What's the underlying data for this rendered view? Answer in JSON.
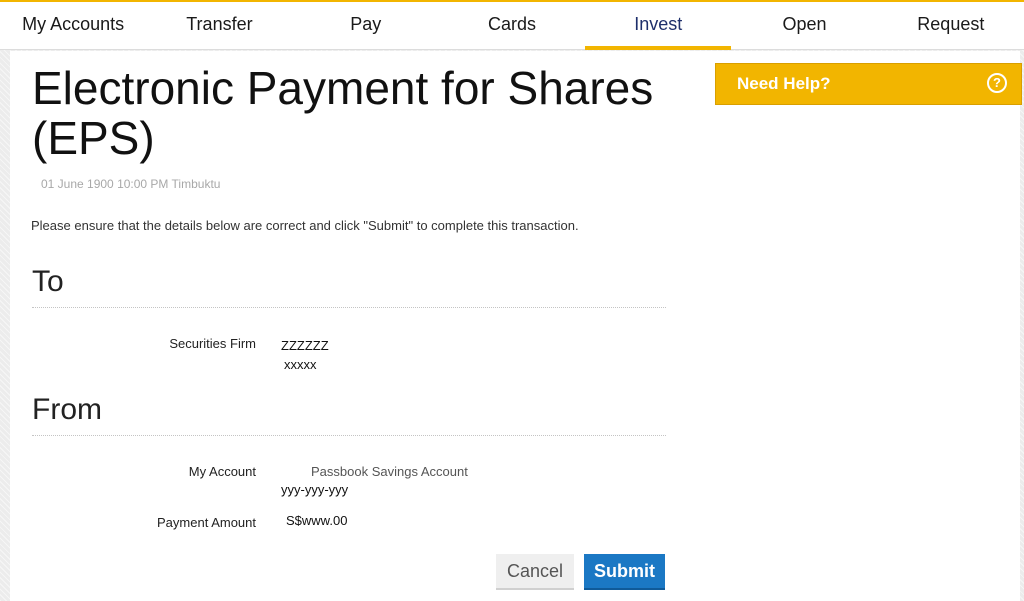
{
  "nav": {
    "items": [
      {
        "label": "My Accounts"
      },
      {
        "label": "Transfer"
      },
      {
        "label": "Pay"
      },
      {
        "label": "Cards"
      },
      {
        "label": "Invest",
        "active": true
      },
      {
        "label": "Open"
      },
      {
        "label": "Request"
      }
    ]
  },
  "page": {
    "title": "Electronic Payment for Shares (EPS)",
    "timestamp": "01 June 1900 10:00 PM Timbuktu",
    "instruction": "Please ensure that the details below are correct and click \"Submit\" to complete this transaction."
  },
  "to_section": {
    "heading": "To",
    "securities_firm_label": "Securities Firm",
    "securities_firm_name": "ZZZZZZ",
    "securities_firm_code": "xxxxx"
  },
  "from_section": {
    "heading": "From",
    "my_account_label": "My Account",
    "account_type": "Passbook Savings Account",
    "account_number": "yyy-yyy-yyy",
    "payment_amount_label": "Payment Amount",
    "payment_amount": "S$www.00"
  },
  "actions": {
    "cancel_label": "Cancel",
    "submit_label": "Submit"
  },
  "help": {
    "label": "Need Help?",
    "icon": "question-circle-icon"
  },
  "colors": {
    "accent": "#f2b500",
    "primary_button": "#1b78c4",
    "active_nav_text": "#1e2f6b"
  }
}
